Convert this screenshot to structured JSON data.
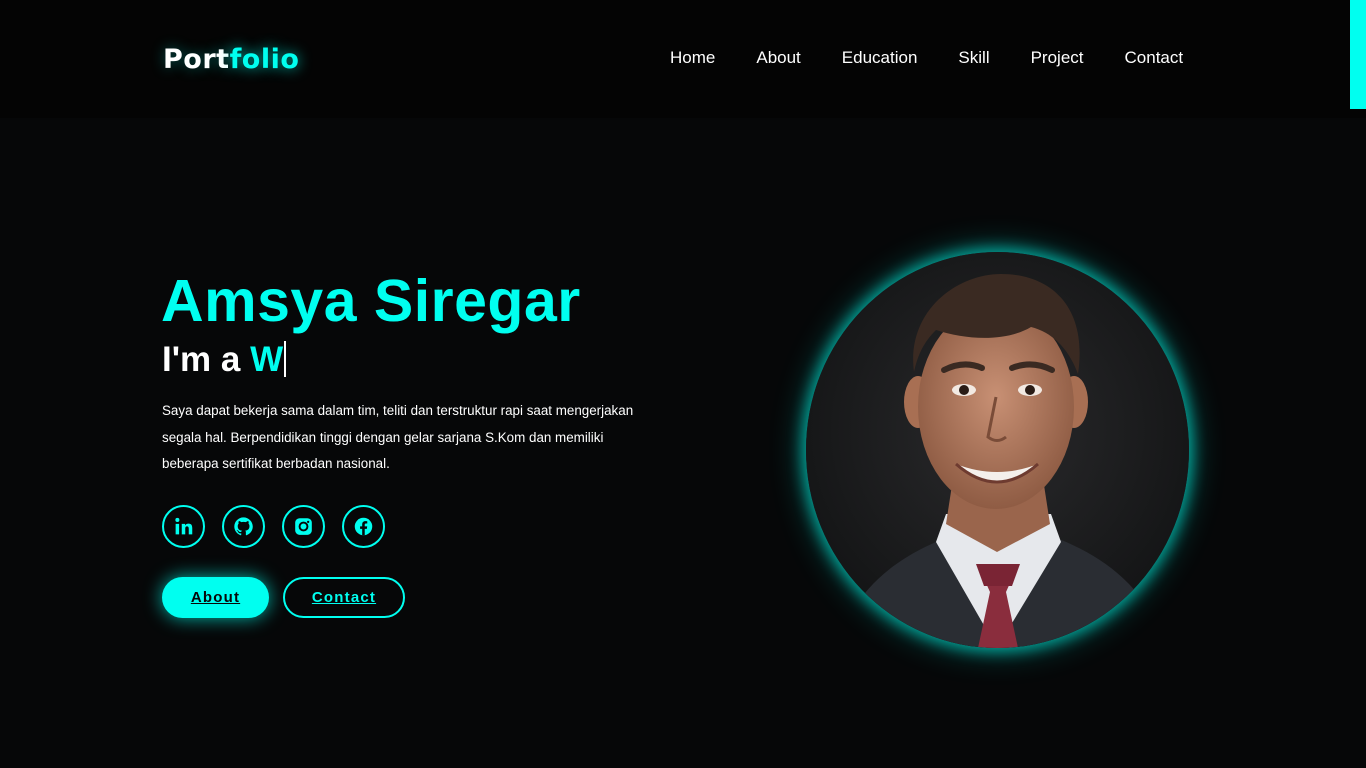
{
  "header": {
    "logo_part1": "Port",
    "logo_part2": "folio",
    "nav": [
      {
        "label": "Home"
      },
      {
        "label": "About"
      },
      {
        "label": "Education"
      },
      {
        "label": "Skill"
      },
      {
        "label": "Project"
      },
      {
        "label": "Contact"
      }
    ]
  },
  "hero": {
    "name": "Amsya Siregar",
    "intro_prefix": "I'm a",
    "typed_text": "W",
    "description": "Saya dapat bekerja sama dalam tim, teliti dan terstruktur rapi saat mengerjakan segala hal. Berpendidikan tinggi dengan gelar sarjana S.Kom dan memiliki beberapa sertifikat berbadan nasional.",
    "socials": [
      {
        "icon": "linkedin-icon"
      },
      {
        "icon": "github-icon"
      },
      {
        "icon": "instagram-icon"
      },
      {
        "icon": "facebook-icon"
      }
    ],
    "buttons": {
      "about": "About",
      "contact": "Contact"
    }
  },
  "colors": {
    "accent": "#00fff0",
    "background": "#060708",
    "header_background": "#040404"
  }
}
